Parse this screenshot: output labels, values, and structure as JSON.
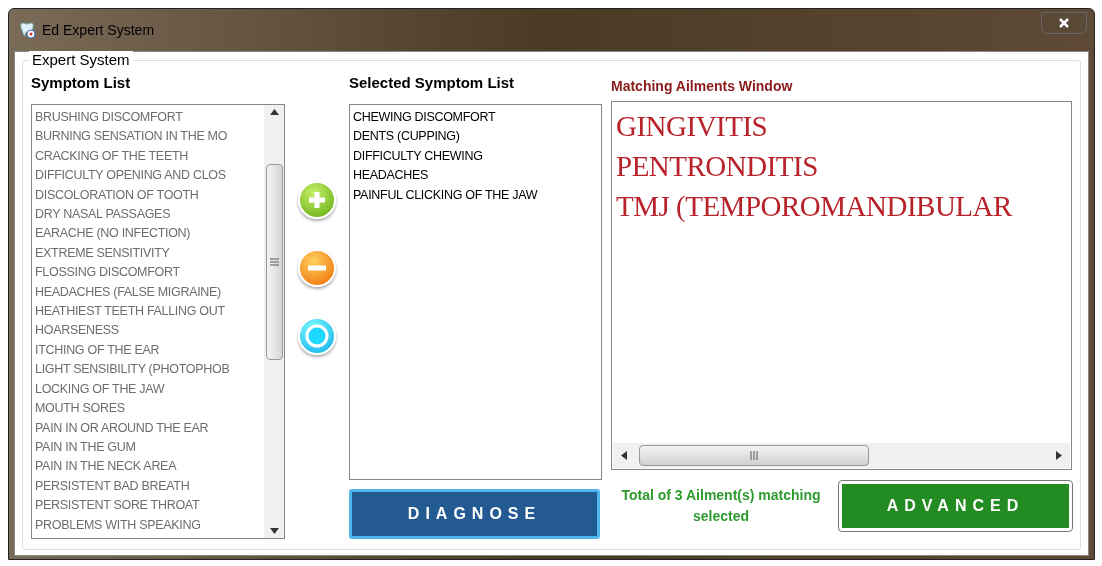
{
  "window": {
    "title": "Ed Expert System"
  },
  "group": {
    "title": "Expert System"
  },
  "symptom_list": {
    "label": "Symptom List",
    "items": [
      "BRUSHING DISCOMFORT",
      "BURNING SENSATION IN THE MO",
      "CRACKING OF THE TEETH",
      "DIFFICULTY OPENING AND CLOS",
      "DISCOLORATION OF TOOTH",
      "DRY NASAL PASSAGES",
      "EARACHE (NO INFECTION)",
      "EXTREME SENSITIVITY",
      "FLOSSING DISCOMFORT",
      "HEADACHES (FALSE MIGRAINE)",
      "HEATHIEST TEETH FALLING OUT",
      "HOARSENESS",
      "ITCHING OF THE EAR",
      "LIGHT SENSIBILITY (PHOTOPHOB",
      "LOCKING OF THE JAW",
      "MOUTH SORES",
      "PAIN IN OR AROUND THE EAR",
      "PAIN IN THE GUM",
      "PAIN IN THE NECK AREA",
      "PERSISTENT BAD BREATH",
      "PERSISTENT SORE THROAT",
      "PROBLEMS WITH SPEAKING"
    ]
  },
  "selected_list": {
    "label": "Selected Symptom List",
    "items": [
      "CHEWING DISCOMFORT",
      "DENTS (CUPPING)",
      "DIFFICULTY CHEWING",
      "HEADACHES",
      "PAINFUL CLICKING OF THE JAW"
    ]
  },
  "matching": {
    "label": "Matching Ailments Window",
    "items": [
      "GINGIVITIS",
      "PENTRONDITIS",
      "TMJ (TEMPOROMANDIBULAR"
    ]
  },
  "diagnose_button": "DIAGNOSE",
  "total": "Total of 3 Ailment(s) matching selected",
  "advanced_button": "ADVANCED"
}
